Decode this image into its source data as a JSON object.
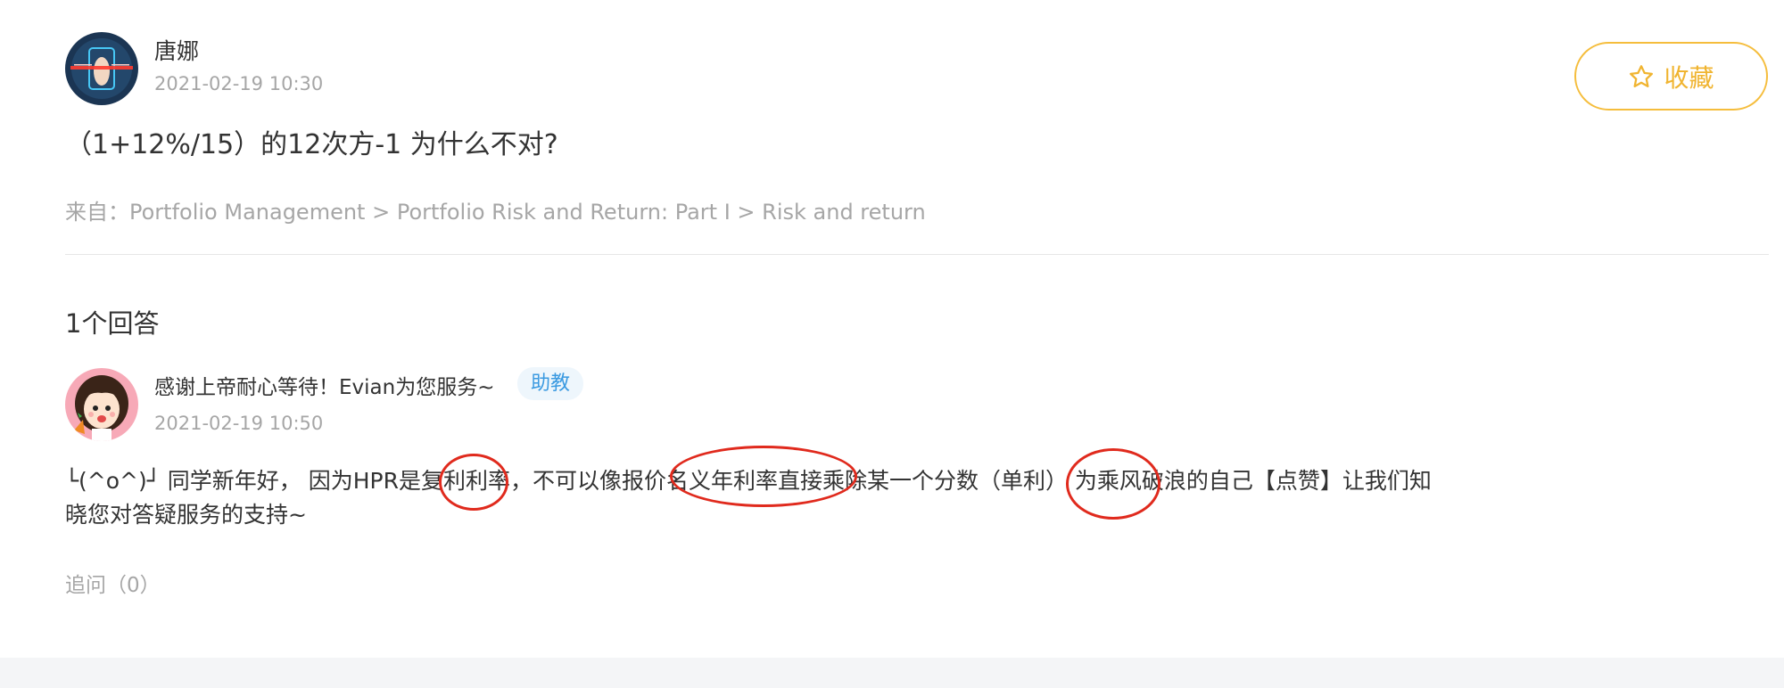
{
  "question": {
    "author": "唐娜",
    "time": "2021-02-19 10:30",
    "title": "（1+12%/15）的12次方-1 为什么不对?",
    "source": "来自：Portfolio Management > Portfolio Risk and Return: Part I > Risk and return"
  },
  "favorite_button": {
    "label": "收藏",
    "icon": "star-outline-icon",
    "color": "#f5bd3c"
  },
  "answers_header": "1个回答",
  "answer": {
    "author": "感谢上帝耐心等待！Evian为您服务~",
    "role_badge": "助教",
    "time": "2021-02-19 10:50",
    "body_line_1": "└(^o^)┘ 同学新年好， 因为HPR是复利利率，不可以像报价名义年利率直接乘除某一个分数（单利） 为乘风破浪的自己【点赞】让我们知",
    "body_line_2": "晓您对答疑服务的支持~",
    "follow_up": "追问（0）"
  },
  "colors": {
    "accent": "#f5bd3c",
    "badge_text": "#3b9ae1",
    "badge_bg": "#eef6fc",
    "annotation": "#e02a1d",
    "muted_text": "#a6a6a6"
  }
}
